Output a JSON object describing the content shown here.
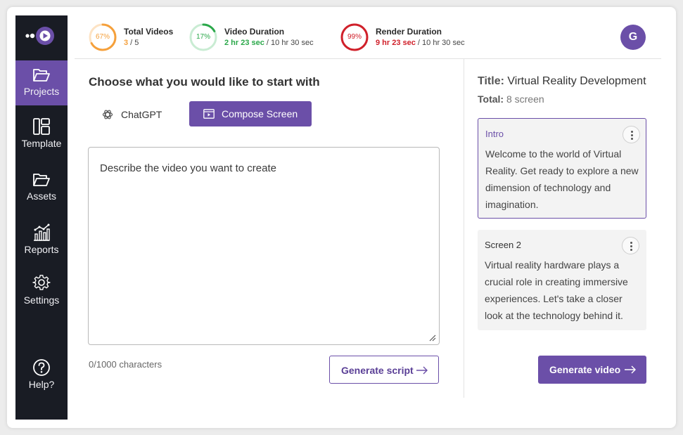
{
  "sidebar": {
    "items": [
      {
        "label": "Projects",
        "icon": "folder-open-icon",
        "active": true
      },
      {
        "label": "Template",
        "icon": "template-layout-icon"
      },
      {
        "label": "Assets",
        "icon": "folder-icon"
      },
      {
        "label": "Reports",
        "icon": "chart-icon"
      },
      {
        "label": "Settings",
        "icon": "gear-icon"
      },
      {
        "label": "Help?",
        "icon": "help-icon"
      }
    ]
  },
  "header": {
    "stats": [
      {
        "title": "Total Videos",
        "percent": 67,
        "percent_label": "67%",
        "used": "3",
        "separator": " / ",
        "total": "5",
        "color": "#f5a03b"
      },
      {
        "title": "Video Duration",
        "percent": 17,
        "percent_label": "17%",
        "used": "2 hr 23 sec",
        "separator": " / ",
        "total": "10 hr 30 sec",
        "color": "#2ba84a"
      },
      {
        "title": "Render Duration",
        "percent": 99,
        "percent_label": "99%",
        "used": "9 hr 23 sec",
        "separator": " / ",
        "total": "10 hr 30 sec",
        "color": "#d0202a"
      }
    ],
    "avatar_initial": "G"
  },
  "main": {
    "heading": "Choose what you would like to start with",
    "modes": {
      "chatgpt_label": "ChatGPT",
      "compose_label": "Compose Screen"
    },
    "prompt_placeholder": "Describe the video you want to create",
    "char_count": "0/1000 characters",
    "generate_script_label": "Generate script"
  },
  "project": {
    "title_label": "Title:",
    "title": "Virtual Reality Development",
    "total_label": "Total:",
    "total": "8 screen",
    "screens": [
      {
        "name": "Intro",
        "text": "Welcome to the world of Virtual Reality. Get ready to explore a new dimension of technology and imagination."
      },
      {
        "name": "Screen 2",
        "text": "Virtual reality hardware plays a crucial role in creating immersive experiences. Let's take a closer look at the technology behind it."
      }
    ],
    "generate_video_label": "Generate video"
  },
  "colors": {
    "accent": "#6b4fa8",
    "sidebar": "#191c24"
  }
}
